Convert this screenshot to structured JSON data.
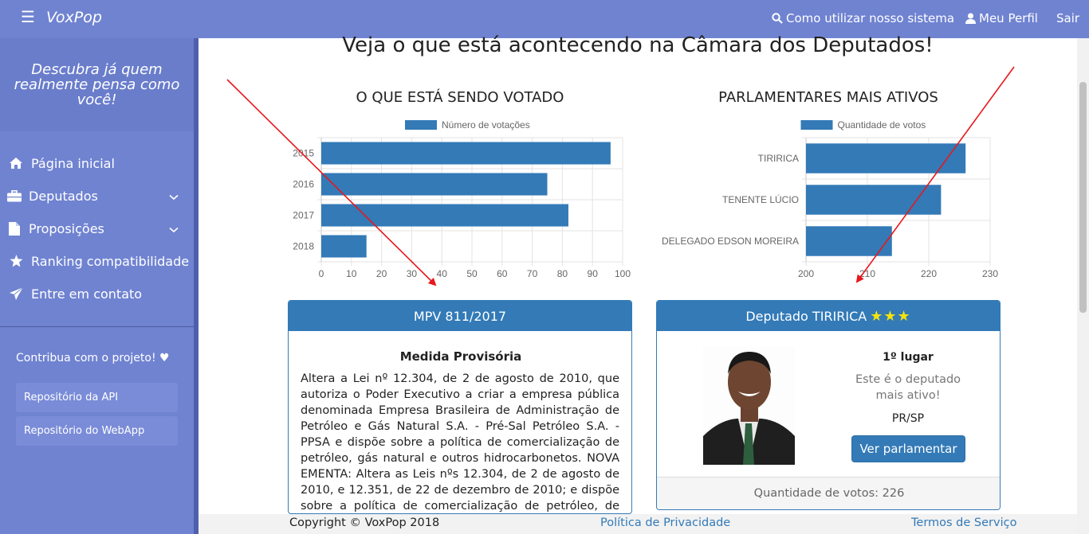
{
  "topbar": {
    "brand": "VoxPop",
    "help_link": "Como utilizar nosso sistema",
    "profile_link": "Meu Perfil",
    "logout_link": "Sair"
  },
  "sidebar": {
    "tagline": "Descubra já quem realmente pensa como você!",
    "items": [
      {
        "label": "Página inicial",
        "icon": "home-icon"
      },
      {
        "label": "Deputados",
        "icon": "briefcase-icon"
      },
      {
        "label": "Proposições",
        "icon": "file-icon"
      },
      {
        "label": "Ranking compatibilidade",
        "icon": "star-icon"
      },
      {
        "label": "Entre em contato",
        "icon": "paper-plane-icon"
      }
    ],
    "contribute": "Contribua com o projeto! ♥",
    "repos": [
      "Repositório da API",
      "Repositório do WebApp"
    ]
  },
  "main": {
    "heading": "Veja o que está acontecendo na Câmara dos Deputados!",
    "chart_titles": [
      "O QUE ESTÁ SENDO VOTADO",
      "PARLAMENTARES MAIS ATIVOS"
    ]
  },
  "chart_data": [
    {
      "type": "bar",
      "orientation": "horizontal",
      "title": "O QUE ESTÁ SENDO VOTADO",
      "categories": [
        "2015",
        "2016",
        "2017",
        "2018"
      ],
      "series": [
        {
          "name": "Número de votações",
          "values": [
            96,
            75,
            82,
            15
          ]
        }
      ],
      "xlim": [
        0,
        100
      ],
      "xticks": [
        0,
        10,
        20,
        30,
        40,
        50,
        60,
        70,
        80,
        90,
        100
      ],
      "grid": true,
      "legend": "top",
      "color": "#337ab7"
    },
    {
      "type": "bar",
      "orientation": "horizontal",
      "title": "PARLAMENTARES MAIS ATIVOS",
      "categories": [
        "TIRIRICA",
        "TENENTE LÚCIO",
        "DELEGADO EDSON MOREIRA"
      ],
      "series": [
        {
          "name": "Quantidade de votos",
          "values": [
            226,
            222,
            214
          ]
        }
      ],
      "xlim": [
        200,
        230
      ],
      "xticks": [
        200,
        210,
        220,
        230
      ],
      "grid": true,
      "legend": "top",
      "color": "#337ab7"
    }
  ],
  "proposal_card": {
    "header": "MPV 811/2017",
    "type": "Medida Provisória",
    "ementa": "Altera a Lei nº 12.304, de 2 de agosto de 2010, que autoriza o Poder Executivo a criar a empresa pública denominada Empresa Brasileira de Administração de Petróleo e Gás Natural S.A. - Pré-Sal Petróleo S.A. - PPSA e dispõe sobre a política de comercialização de petróleo, gás natural e outros hidrocarbonetos.  NOVA EMENTA: Altera as Leis nºs 12.304, de 2 de agosto de 2010, e 12.351, de 22 de dezembro de 2010; e dispõe sobre a política de comercialização de petróleo, de gás natural e de outros hidrocarbonetos."
  },
  "deputy_card": {
    "header": "Deputado TIRIRICA",
    "stars": "★★★",
    "rank": "1º lugar",
    "description": "Este é o deputado mais ativo!",
    "party": "PR/SP",
    "button": "Ver parlamentar",
    "footer": "Quantidade de votos: 226"
  },
  "footer": {
    "copyright": "Copyright © VoxPop 2018",
    "privacy": "Política de Privacidade",
    "terms": "Termos de Serviço"
  },
  "colors": {
    "navbar": "#7083d1",
    "primary": "#337ab7",
    "annotation_arrow": "#e8171c"
  }
}
